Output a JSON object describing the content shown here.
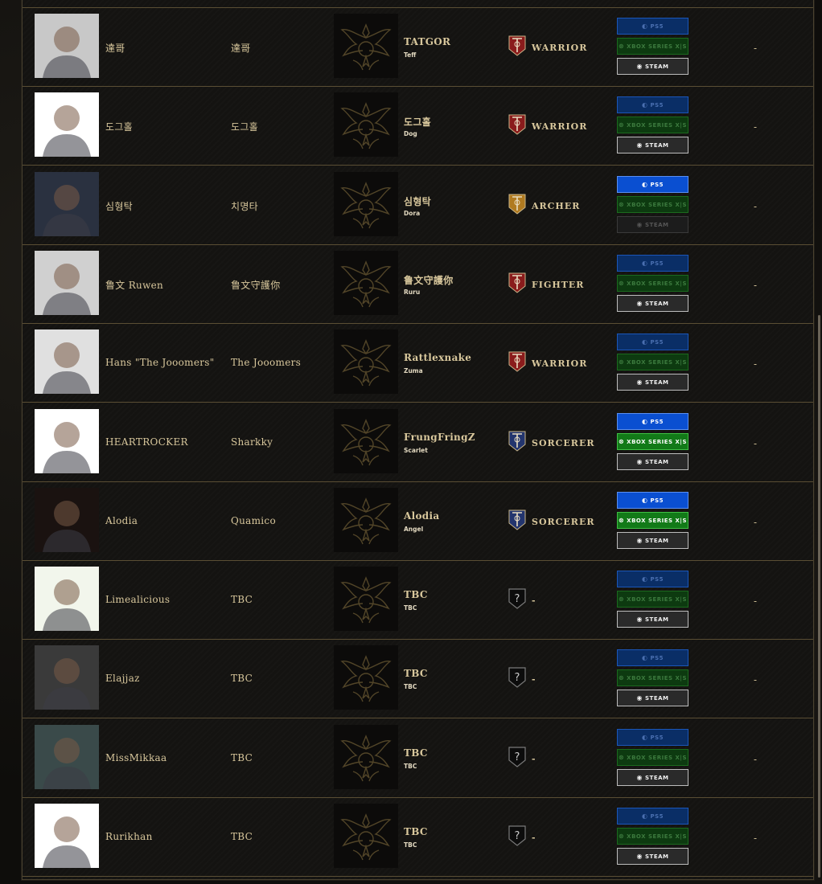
{
  "platform_labels": {
    "ps5": "PS5",
    "xbox": "XBOX SERIES X|S",
    "steam": "STEAM"
  },
  "rows": [
    {
      "streamer": "達哥",
      "character": "達哥",
      "pawn": "TATGOR",
      "pawn_sub": "Teff",
      "class": "WARRIOR",
      "class_color": "#8a1c1c",
      "ps5": false,
      "xbox": false,
      "steam": true,
      "extra": "-",
      "avatar_bg": "#c8c8c8"
    },
    {
      "streamer": "도그홀",
      "character": "도그홀",
      "pawn": "도그홀",
      "pawn_sub": "Dog",
      "class": "WARRIOR",
      "class_color": "#8a1c1c",
      "ps5": false,
      "xbox": false,
      "steam": true,
      "extra": "-",
      "avatar_bg": "#ffffff"
    },
    {
      "streamer": "심형탁",
      "character": "치명타",
      "pawn": "심형탁",
      "pawn_sub": "Dora",
      "class": "ARCHER",
      "class_color": "#b07a20",
      "ps5": true,
      "xbox": false,
      "steam": false,
      "extra": "-",
      "avatar_bg": "#2a3140"
    },
    {
      "streamer": "鲁文 Ruwen",
      "character": "鲁文守護你",
      "pawn": "鲁文守護你",
      "pawn_sub": "Ruru",
      "class": "FIGHTER",
      "class_color": "#8a1c1c",
      "ps5": false,
      "xbox": false,
      "steam": true,
      "extra": "-",
      "avatar_bg": "#d0d0d0"
    },
    {
      "streamer": "Hans \"The Jooomers\"",
      "character": "The Jooomers",
      "pawn": "Rattlexnake",
      "pawn_sub": "Zuma",
      "class": "WARRIOR",
      "class_color": "#8a1c1c",
      "ps5": false,
      "xbox": false,
      "steam": true,
      "extra": "-",
      "avatar_bg": "#e0e0e0"
    },
    {
      "streamer": "HEARTROCKER",
      "character": "Sharkky",
      "pawn": "FrungFringZ",
      "pawn_sub": "Scarlet",
      "class": "SORCERER",
      "class_color": "#23356e",
      "ps5": true,
      "xbox": true,
      "steam": true,
      "extra": "-",
      "avatar_bg": "#ffffff"
    },
    {
      "streamer": "Alodia",
      "character": "Quamico",
      "pawn": "Alodia",
      "pawn_sub": "Angel",
      "class": "SORCERER",
      "class_color": "#23356e",
      "ps5": true,
      "xbox": true,
      "steam": true,
      "extra": "-",
      "avatar_bg": "#1a1210"
    },
    {
      "streamer": "Limealicious",
      "character": "TBC",
      "pawn": "TBC",
      "pawn_sub": "TBC",
      "class": "-",
      "class_color": "#1a1a1a",
      "ps5": false,
      "xbox": false,
      "steam": true,
      "extra": "-",
      "avatar_bg": "#f2f6ec"
    },
    {
      "streamer": "Elajjaz",
      "character": "TBC",
      "pawn": "TBC",
      "pawn_sub": "TBC",
      "class": "-",
      "class_color": "#1a1a1a",
      "ps5": false,
      "xbox": false,
      "steam": true,
      "extra": "-",
      "avatar_bg": "#3a3a3a"
    },
    {
      "streamer": "MissMikkaa",
      "character": "TBC",
      "pawn": "TBC",
      "pawn_sub": "TBC",
      "class": "-",
      "class_color": "#1a1a1a",
      "ps5": false,
      "xbox": false,
      "steam": true,
      "extra": "-",
      "avatar_bg": "#3a4a4a"
    },
    {
      "streamer": "Rurikhan",
      "character": "TBC",
      "pawn": "TBC",
      "pawn_sub": "TBC",
      "class": "-",
      "class_color": "#1a1a1a",
      "ps5": false,
      "xbox": false,
      "steam": true,
      "extra": "-",
      "avatar_bg": "#ffffff"
    }
  ]
}
